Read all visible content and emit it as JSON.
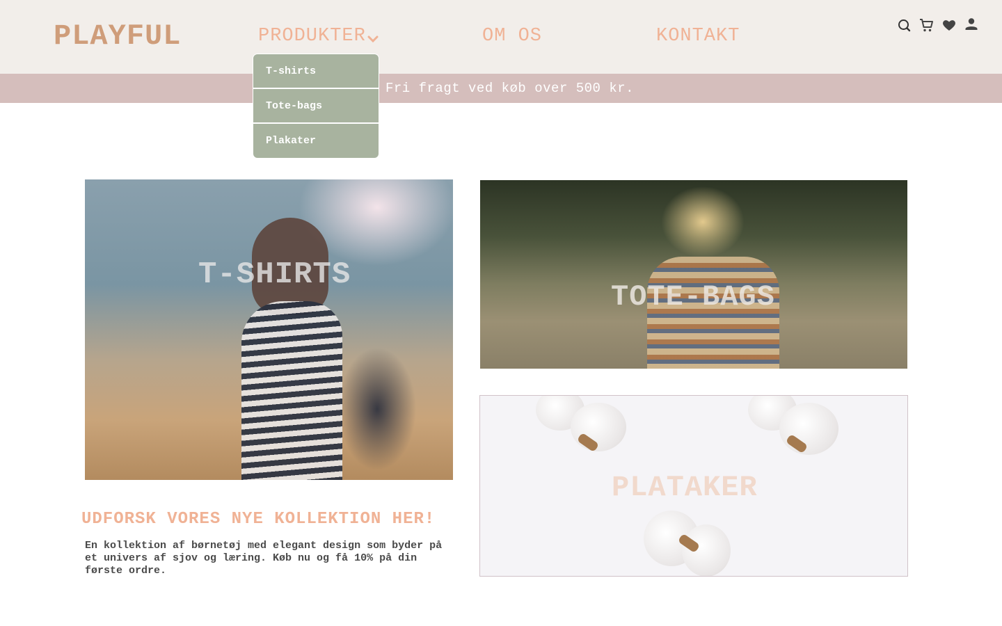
{
  "header": {
    "logo": "PLAYFUL",
    "nav": {
      "produkter": "PRODUKTER",
      "om_os": "OM OS",
      "kontakt": "KONTAKT"
    },
    "icons": [
      "search-icon",
      "cart-icon",
      "heart-icon",
      "user-icon"
    ]
  },
  "dropdown": {
    "items": [
      "T-shirts",
      "Tote-bags",
      "Plakater"
    ]
  },
  "banner": {
    "text": "Fri fragt ved køb over 500 kr."
  },
  "tiles": {
    "tshirts": "T-SHIRTS",
    "totebags": "TOTE-BAGS",
    "plataker": "PLATAKER"
  },
  "intro": {
    "headline": "UDFORSK VORES NYE KOLLEKTION HER!",
    "paragraph": "En kollektion af børnetøj med elegant design som byder på et univers af sjov og læring. Køb nu og få 10% på din første ordre."
  },
  "colors": {
    "header_bg": "#f2eeea",
    "logo": "#cf9d7a",
    "nav_text": "#f0b295",
    "banner_bg": "#d5bebc",
    "dropdown_bg": "#a8b39f",
    "paragraph_text": "#4a4a4a"
  }
}
